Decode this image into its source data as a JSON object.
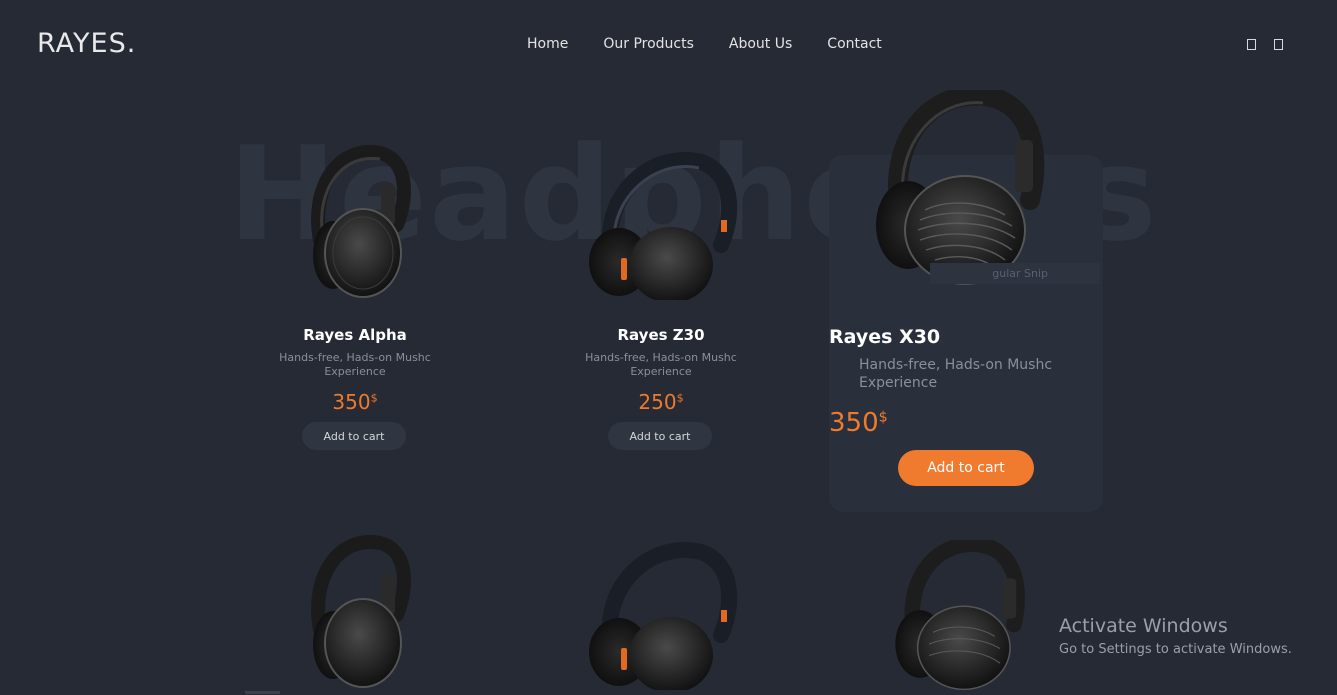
{
  "header": {
    "logo": "RAYES.",
    "nav": [
      "Home",
      "Our Products",
      "About Us",
      "Contact"
    ],
    "icons": [
      "user-icon",
      "cart-icon"
    ]
  },
  "background_word": "Headphones",
  "products": [
    {
      "name": "Rayes Alpha",
      "desc": "Hands-free, Hads-on Mushc Experience",
      "price": "350",
      "currency": "$",
      "button": "Add to cart",
      "style": "over-ear-silver"
    },
    {
      "name": "Rayes Z30",
      "desc": "Hands-free, Hads-on Mushc Experience",
      "price": "250",
      "currency": "$",
      "button": "Add to cart",
      "style": "on-ear-orange"
    },
    {
      "name": "Rayes X30",
      "desc": "Hands-free, Hads-on Mushc Experience",
      "price": "350",
      "currency": "$",
      "button": "Add to cart",
      "style": "over-ear-ribbed",
      "active": true
    }
  ],
  "overlay_snip_text": "gular Snip",
  "windows_watermark": {
    "title": "Activate Windows",
    "subtitle": "Go to Settings to activate Windows."
  },
  "colors": {
    "background": "#252a34",
    "accent": "#ef7a2c",
    "card_active": "#2a303b"
  }
}
